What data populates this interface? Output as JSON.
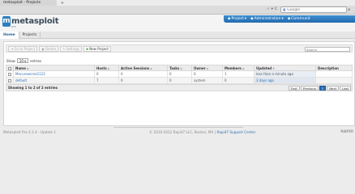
{
  "browser": {
    "tab_title": "metasploit - Projects",
    "tab_new": "+",
    "nav_buttons": [
      "☆",
      "▾",
      "C"
    ],
    "search_engine": "g",
    "search_placeholder": "Google",
    "home": "⌂"
  },
  "app": {
    "logo_text": "metasploit",
    "logo_sub": "pro",
    "topnav": [
      {
        "label": "Project",
        "icon": "▾"
      },
      {
        "label": "Administration",
        "icon": "▾"
      },
      {
        "label": "Communit"
      }
    ],
    "subnav": [
      {
        "label": "Home",
        "active": true
      },
      {
        "label": "Projects",
        "active": false
      }
    ]
  },
  "toolbar": {
    "go_to_project": "Go to Project",
    "delete": "Delete",
    "settings": "Settings",
    "new_project": "New Project",
    "search_placeholder": "Search"
  },
  "show": {
    "label_show": "Show",
    "value": "10",
    "label_entries": "entries"
  },
  "table": {
    "columns": [
      "Name",
      "Hosts",
      "Active Sessions",
      "Tasks",
      "Owner",
      "Members",
      "Updated",
      "Description"
    ],
    "rows": [
      {
        "name": "Mecurewnrez1122",
        "hosts": "0",
        "sessions": "0",
        "tasks": "0",
        "owner": "0",
        "members": "1",
        "updated": "less than a minute ago",
        "description": ""
      },
      {
        "name": "default",
        "hosts": "7",
        "sessions": "0",
        "tasks": "0",
        "owner": "system",
        "members": "0",
        "updated": "3 days ago",
        "description": ""
      }
    ],
    "summary": "Showing 1 to 2 of 2 entries",
    "pager": [
      "First",
      "Previous",
      "1",
      "Next",
      "Last"
    ]
  },
  "footer": {
    "version": "Metasploit Pro 4.1.4 - Update 1",
    "copyright": "© 2010-2012 Rapid7 LLC, Boston, MA |",
    "support": "Rapid7 Support Center",
    "brand": "RAPID"
  },
  "colors": {
    "accent": "#236bb0",
    "link": "#2f6fb0"
  }
}
